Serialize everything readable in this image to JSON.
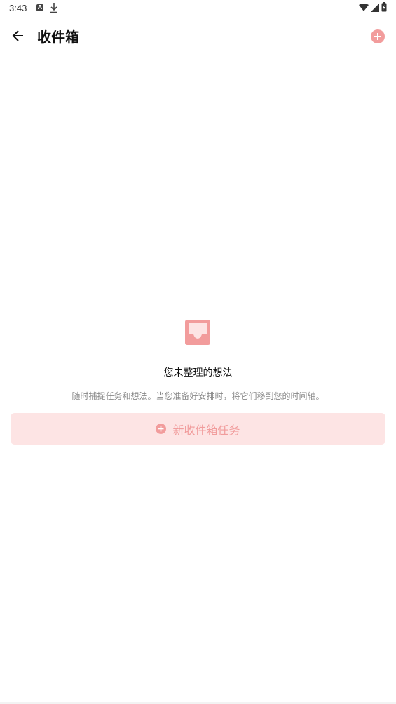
{
  "status_bar": {
    "time": "3:43",
    "notif_icon_a": "A",
    "icons": [
      "notification-a-icon",
      "download-icon",
      "wifi-icon",
      "signal-icon",
      "battery-icon"
    ]
  },
  "app_bar": {
    "title": "收件箱",
    "back_icon": "arrow-left-icon",
    "add_icon": "plus-circle-icon"
  },
  "empty_state": {
    "icon": "inbox-icon",
    "title": "您未整理的想法",
    "description": "随时捕捉任务和想法。当您准备好安排时，将它们移到您的时间轴。",
    "button_label": "新收件箱任务"
  },
  "colors": {
    "accent": "#f29c9c",
    "button_bg": "#fde4e4",
    "text_primary": "#111111",
    "text_secondary": "#888888"
  }
}
